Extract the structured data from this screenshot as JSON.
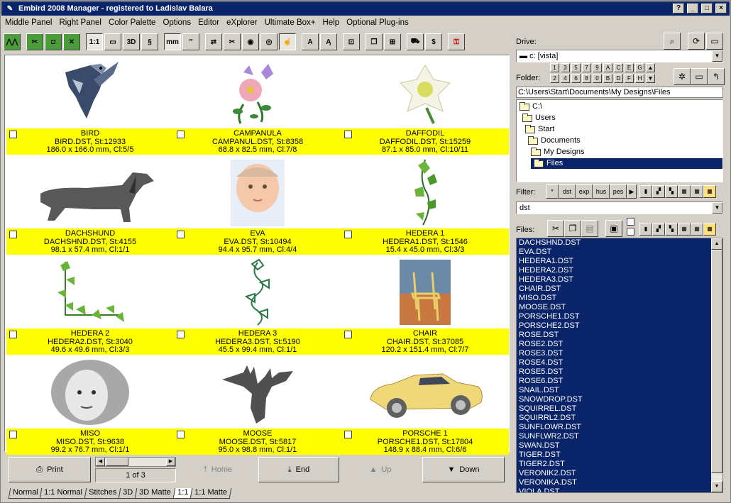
{
  "window": {
    "title": "Embird 2008 Manager - registered to Ladislav Balara"
  },
  "titlebar_buttons": {
    "help": "?",
    "minimize": "_",
    "maximize": "□",
    "close": "×"
  },
  "menu": [
    "Middle Panel",
    "Right Panel",
    "Color Palette",
    "Options",
    "Editor",
    "eXplorer",
    "Ultimate Box+",
    "Help",
    "Optional Plug-ins"
  ],
  "toolbar": {
    "zoom_1_1": "1:1",
    "view_3d": "3D",
    "mm": "mm",
    "text_a": "A"
  },
  "designs": [
    {
      "name": "BIRD",
      "file": "BIRD.DST, St:12933",
      "dims": "186.0 x 166.0 mm, Cl:5/5",
      "icon": "bird-embroidery-icon"
    },
    {
      "name": "CAMPANULA",
      "file": "CAMPANUL.DST, St:8358",
      "dims": "68.8 x 82.5 mm, Cl:7/8",
      "icon": "flower-embroidery-icon"
    },
    {
      "name": "DAFFODIL",
      "file": "DAFFODIL.DST, St:15259",
      "dims": "87.1 x 85.0 mm, Cl:10/11",
      "icon": "daffodil-embroidery-icon"
    },
    {
      "name": "DACHSHUND",
      "file": "DACHSHND.DST, St:4155",
      "dims": "98.1 x 57.4 mm, Cl:1/1",
      "icon": "dog-embroidery-icon"
    },
    {
      "name": "EVA",
      "file": "EVA.DST, St:10494",
      "dims": "94.4 x 95.7 mm, Cl:4/4",
      "icon": "baby-face-embroidery-icon"
    },
    {
      "name": "HEDERA 1",
      "file": "HEDERA1.DST, St:1546",
      "dims": "15.4 x 45.0 mm, Cl:3/3",
      "icon": "ivy-embroidery-icon"
    },
    {
      "name": "HEDERA 2",
      "file": "HEDERA2.DST, St:3040",
      "dims": "49.6 x 49.6 mm, Cl:3/3",
      "icon": "ivy-corner-embroidery-icon"
    },
    {
      "name": "HEDERA 3",
      "file": "HEDERA3.DST, St:5190",
      "dims": "45.5 x 99.4 mm, Cl:1/1",
      "icon": "ivy-outline-embroidery-icon"
    },
    {
      "name": "CHAIR",
      "file": "CHAIR.DST, St:37085",
      "dims": "120.2 x 151.4 mm, Cl:7/7",
      "icon": "chair-painting-embroidery-icon"
    },
    {
      "name": "MISO",
      "file": "MISO.DST, St:9638",
      "dims": "99.2 x 76.7 mm, Cl:1/1",
      "icon": "child-portrait-embroidery-icon"
    },
    {
      "name": "MOOSE",
      "file": "MOOSE.DST, St:5817",
      "dims": "95.0 x 98.8 mm, Cl:1/1",
      "icon": "moose-embroidery-icon"
    },
    {
      "name": "PORSCHE 1",
      "file": "PORSCHE1.DST, St:17804",
      "dims": "148.9 x 88.4 mm, Cl:6/6",
      "icon": "car-embroidery-icon"
    }
  ],
  "bottom": {
    "print": "Print",
    "page": "1 of 3",
    "home": "Home",
    "end": "End",
    "up": "Up",
    "down": "Down"
  },
  "tabs": [
    "Normal",
    "1:1 Normal",
    "Stitches",
    "3D",
    "3D Matte",
    "1:1",
    "1:1 Matte"
  ],
  "active_tab": "1:1",
  "right_panel": {
    "drive_label": "Drive:",
    "drive_value": "c: [vista]",
    "folder_label": "Folder:",
    "keypad_row1": [
      "1",
      "3",
      "5",
      "7",
      "9",
      "A",
      "C",
      "E",
      "G"
    ],
    "keypad_row2": [
      "2",
      "4",
      "6",
      "8",
      "0",
      "B",
      "D",
      "F",
      "H"
    ],
    "path": "C:\\Users\\Start\\Documents\\My Designs\\Files",
    "tree": [
      "C:\\",
      "Users",
      "Start",
      "Documents",
      "My Designs",
      "Files"
    ],
    "filter_label": "Filter:",
    "filter_buttons": [
      "*",
      "dst",
      "exp",
      "hus",
      "pes"
    ],
    "filter_value": "dst",
    "files_label": "Files:",
    "files": [
      "DACHSHND.DST",
      "EVA.DST",
      "HEDERA1.DST",
      "HEDERA2.DST",
      "HEDERA3.DST",
      "CHAIR.DST",
      "MISO.DST",
      "MOOSE.DST",
      "PORSCHE1.DST",
      "PORSCHE2.DST",
      "ROSE.DST",
      "ROSE2.DST",
      "ROSE3.DST",
      "ROSE4.DST",
      "ROSE5.DST",
      "ROSE6.DST",
      "SNAIL.DST",
      "SNOWDROP.DST",
      "SQUIRREL.DST",
      "SQUIRRL2.DST",
      "SUNFLOWR.DST",
      "SUNFLWR2.DST",
      "SWAN.DST",
      "TIGER.DST",
      "TIGER2.DST",
      "VERONIK2.DST",
      "VERONIKA.DST",
      "VIOLA.DST"
    ]
  },
  "colors": {
    "caption_bg": "#ffff00",
    "selection_bg": "#0a246a",
    "title_bg": "#0a246a"
  }
}
